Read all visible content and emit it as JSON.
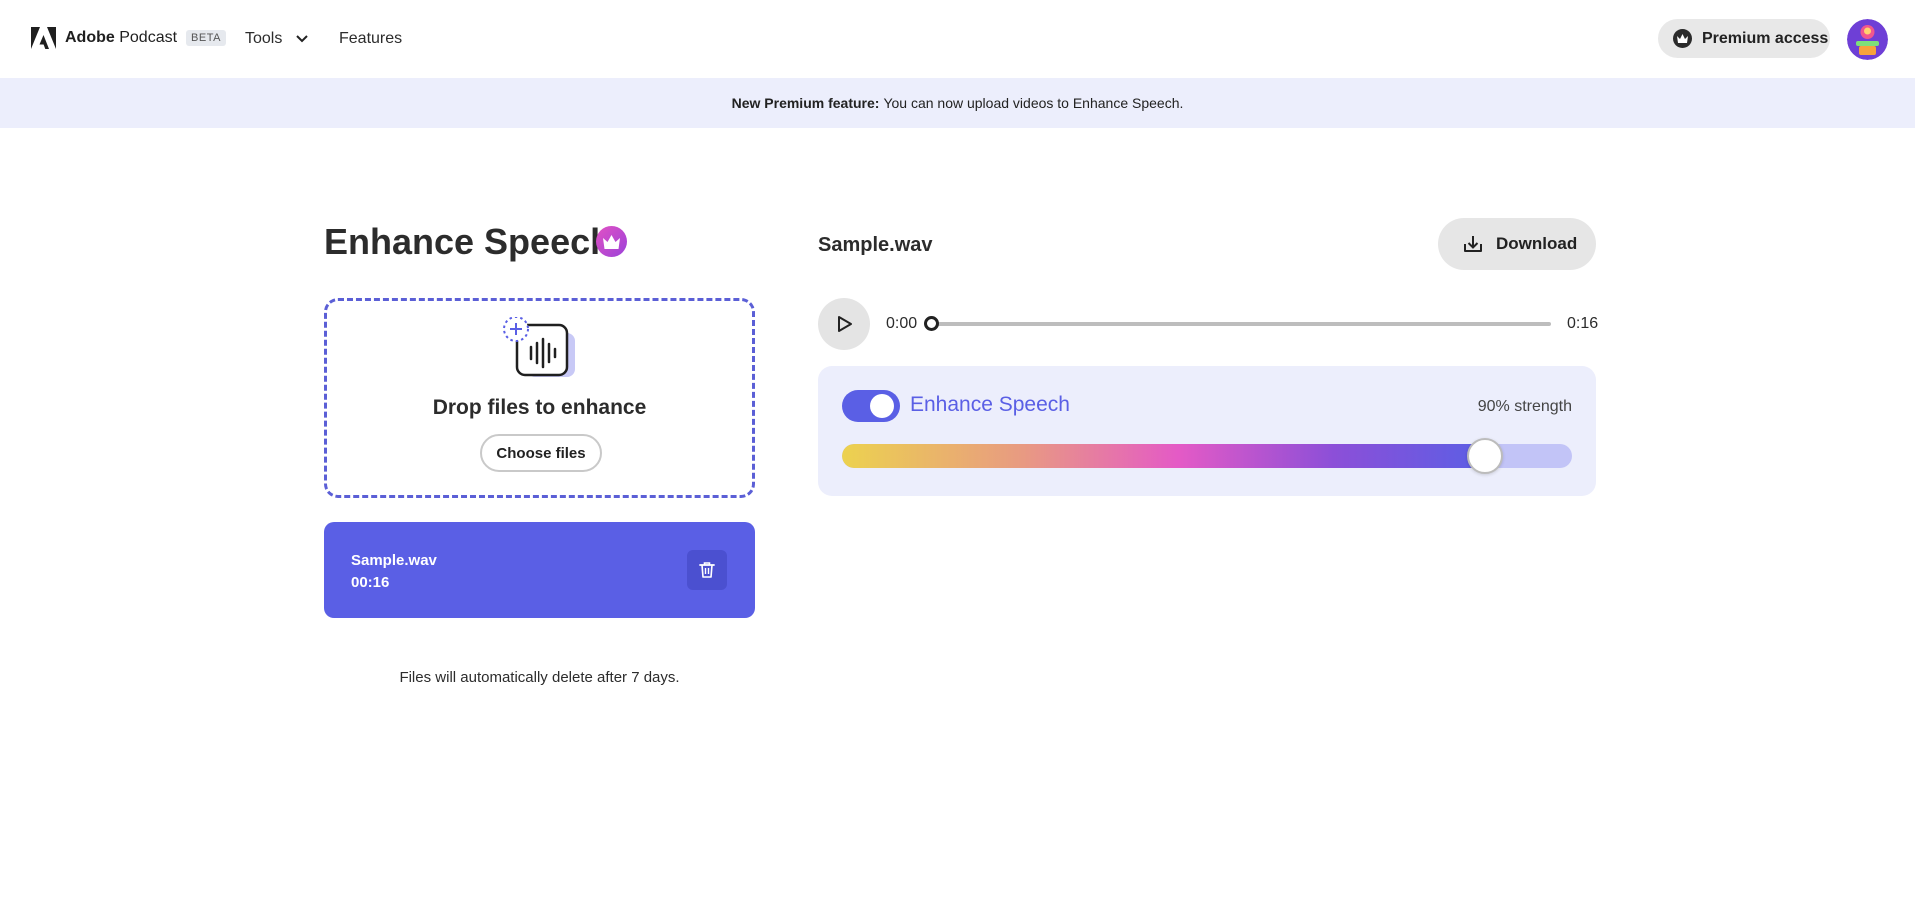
{
  "header": {
    "brand": {
      "name_bold": "Adobe",
      "name_rest": "Podcast",
      "badge": "BETA"
    },
    "nav": {
      "tools": "Tools",
      "features": "Features"
    },
    "premium_label": "Premium access"
  },
  "banner": {
    "bold": "New Premium feature:",
    "text": "You can now upload videos to Enhance Speech."
  },
  "left": {
    "title": "Enhance Speech",
    "dropzone": {
      "text": "Drop files to enhance",
      "button": "Choose files"
    },
    "file": {
      "name": "Sample.wav",
      "duration": "00:16"
    },
    "notice": "Files will automatically delete after 7 days."
  },
  "player": {
    "file_name": "Sample.wav",
    "download_label": "Download",
    "current_time": "0:00",
    "total_time": "0:16",
    "progress": 0
  },
  "enhance": {
    "label": "Enhance Speech",
    "enabled": true,
    "strength_text": "90% strength",
    "strength": 0.9
  },
  "colors": {
    "accent": "#5a5fe5",
    "banner_bg": "#eceefc",
    "panel_bg": "#eceefc"
  }
}
